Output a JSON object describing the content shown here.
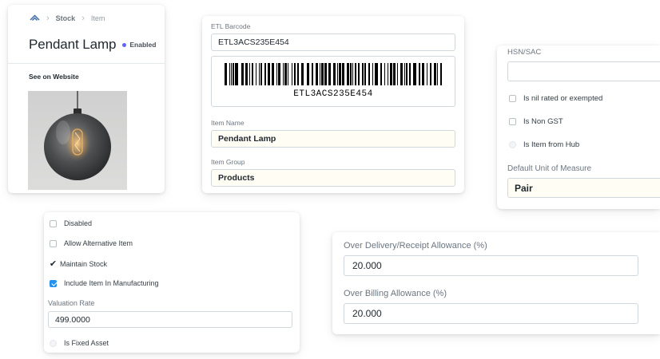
{
  "breadcrumb": {
    "first": "Stock",
    "second": "Item"
  },
  "item": {
    "title": "Pendant Lamp",
    "status": "Enabled",
    "see_on_website": "See on Website"
  },
  "barcode": {
    "label": "ETL Barcode",
    "value": "ETL3ACS235E454",
    "display_text": "ETL3ACS235E454"
  },
  "item_name": {
    "label": "Item Name",
    "value": "Pendant Lamp"
  },
  "item_group": {
    "label": "Item Group",
    "value": "Products"
  },
  "hsn": {
    "label": "HSN/SAC",
    "value": "",
    "checks": [
      {
        "label": "Is nil rated or exempted",
        "checked": false
      },
      {
        "label": "Is Non GST",
        "checked": false
      },
      {
        "label": "Is Item from Hub",
        "checked": false
      }
    ],
    "uom_label": "Default Unit of Measure",
    "uom_value": "Pair"
  },
  "stock_flags": {
    "disabled": "Disabled",
    "allow_alternative": "Allow Alternative Item",
    "maintain_stock": "Maintain Stock",
    "include_manufacturing": "Include Item In Manufacturing",
    "valuation_rate_label": "Valuation Rate",
    "valuation_rate_value": "499.0000",
    "is_fixed_asset": "Is Fixed Asset"
  },
  "allowance": {
    "delivery_label": "Over Delivery/Receipt Allowance (%)",
    "delivery_value": "20.000",
    "billing_label": "Over Billing Allowance (%)",
    "billing_value": "20.000"
  },
  "colors": {
    "accent": "#2490ef",
    "status_dot": "#5e64ff",
    "highlight_field": "#fffdf4",
    "logo": "#3f6ba8"
  }
}
